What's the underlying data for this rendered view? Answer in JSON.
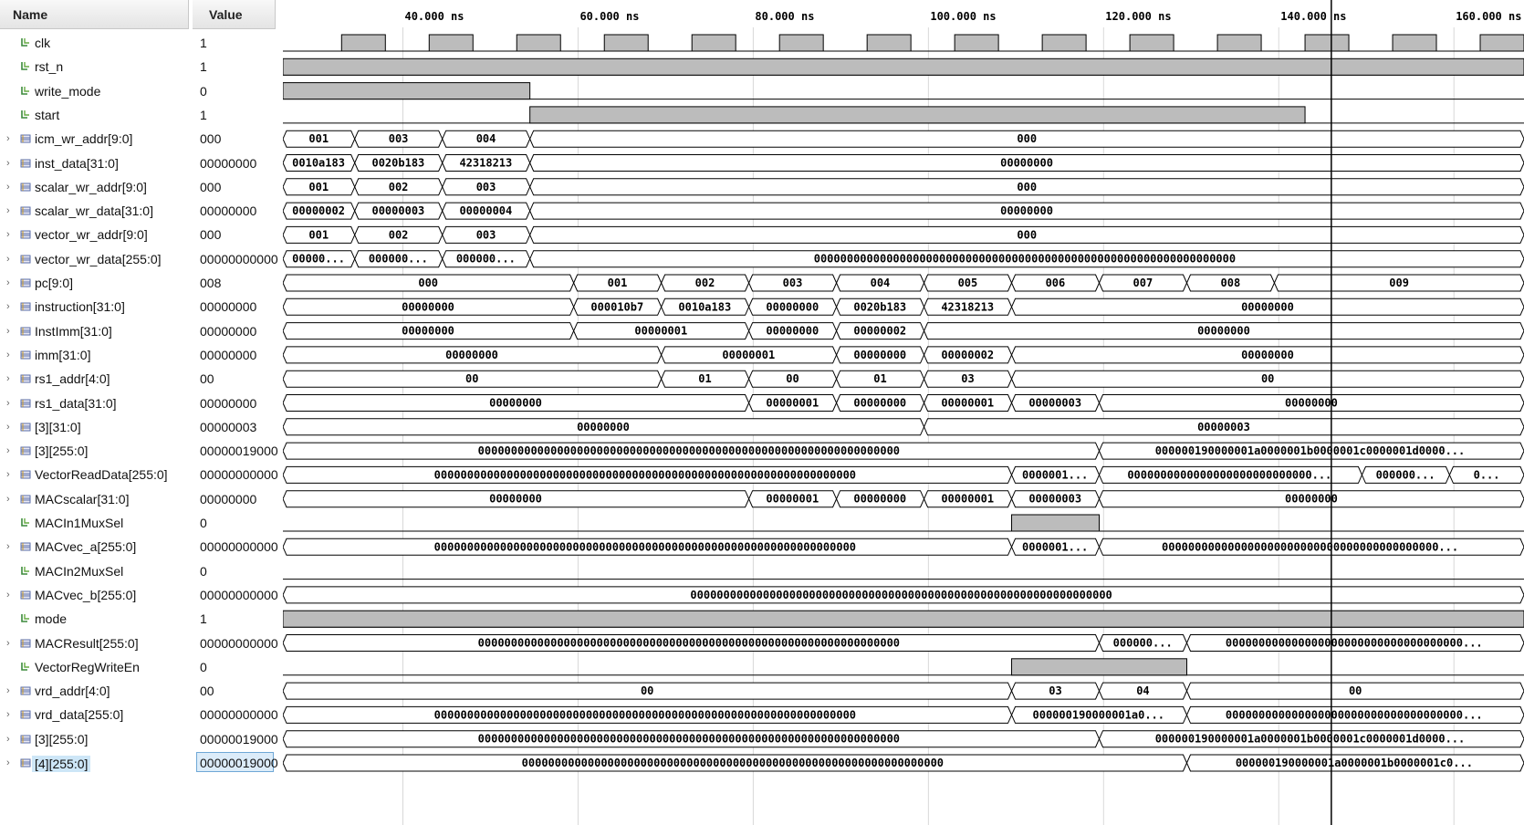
{
  "headers": {
    "name": "Name",
    "value": "Value"
  },
  "timeline": {
    "ticks": [
      "40.000 ns",
      "60.000 ns",
      "80.000 ns",
      "100.000 ns",
      "120.000 ns",
      "140.000 ns",
      "160.000 ns"
    ],
    "tick_ns": [
      40,
      60,
      80,
      100,
      120,
      140,
      160
    ],
    "start_ns": 26.3,
    "end_ns": 168.0,
    "cursor_ns": 146.0
  },
  "signals": [
    {
      "name": "clk",
      "value": "1",
      "kind": "bit",
      "clock": {
        "period": 10,
        "first_rise": 33
      }
    },
    {
      "name": "rst_n",
      "value": "1",
      "kind": "bit",
      "high": [
        [
          26.3,
          168
        ]
      ]
    },
    {
      "name": "write_mode",
      "value": "0",
      "kind": "bit",
      "high": [
        [
          26.3,
          54.5
        ]
      ]
    },
    {
      "name": "start",
      "value": "1",
      "kind": "bit",
      "high": [
        [
          54.5,
          143
        ]
      ]
    },
    {
      "name": "icm_wr_addr[9:0]",
      "value": "000",
      "kind": "bus",
      "segs": [
        [
          26.3,
          34.5,
          "001"
        ],
        [
          34.5,
          44.5,
          "003"
        ],
        [
          44.5,
          54.5,
          "004"
        ],
        [
          54.5,
          168,
          "000"
        ]
      ]
    },
    {
      "name": "inst_data[31:0]",
      "value": "00000000",
      "kind": "bus",
      "segs": [
        [
          26.3,
          34.5,
          "0010a183"
        ],
        [
          34.5,
          44.5,
          "0020b183"
        ],
        [
          44.5,
          54.5,
          "42318213"
        ],
        [
          54.5,
          168,
          "00000000"
        ]
      ]
    },
    {
      "name": "scalar_wr_addr[9:0]",
      "value": "000",
      "kind": "bus",
      "segs": [
        [
          26.3,
          34.5,
          "001"
        ],
        [
          34.5,
          44.5,
          "002"
        ],
        [
          44.5,
          54.5,
          "003"
        ],
        [
          54.5,
          168,
          "000"
        ]
      ]
    },
    {
      "name": "scalar_wr_data[31:0]",
      "value": "00000000",
      "kind": "bus",
      "segs": [
        [
          26.3,
          34.5,
          "00000002"
        ],
        [
          34.5,
          44.5,
          "00000003"
        ],
        [
          44.5,
          54.5,
          "00000004"
        ],
        [
          54.5,
          168,
          "00000000"
        ]
      ]
    },
    {
      "name": "vector_wr_addr[9:0]",
      "value": "000",
      "kind": "bus",
      "segs": [
        [
          26.3,
          34.5,
          "001"
        ],
        [
          34.5,
          44.5,
          "002"
        ],
        [
          44.5,
          54.5,
          "003"
        ],
        [
          54.5,
          168,
          "000"
        ]
      ]
    },
    {
      "name": "vector_wr_data[255:0]",
      "value": "00000000000",
      "kind": "bus",
      "segs": [
        [
          26.3,
          34.5,
          "00000..."
        ],
        [
          34.5,
          44.5,
          "000000..."
        ],
        [
          44.5,
          54.5,
          "000000..."
        ],
        [
          54.5,
          168,
          "0000000000000000000000000000000000000000000000000000000000000000"
        ]
      ]
    },
    {
      "name": "pc[9:0]",
      "value": "008",
      "kind": "bus",
      "segs": [
        [
          26.3,
          59.5,
          "000"
        ],
        [
          59.5,
          69.5,
          "001"
        ],
        [
          69.5,
          79.5,
          "002"
        ],
        [
          79.5,
          89.5,
          "003"
        ],
        [
          89.5,
          99.5,
          "004"
        ],
        [
          99.5,
          109.5,
          "005"
        ],
        [
          109.5,
          119.5,
          "006"
        ],
        [
          119.5,
          129.5,
          "007"
        ],
        [
          129.5,
          139.5,
          "008"
        ],
        [
          139.5,
          168,
          "009"
        ]
      ]
    },
    {
      "name": "instruction[31:0]",
      "value": "00000000",
      "kind": "bus",
      "segs": [
        [
          26.3,
          59.5,
          "00000000"
        ],
        [
          59.5,
          69.5,
          "000010b7"
        ],
        [
          69.5,
          79.5,
          "0010a183"
        ],
        [
          79.5,
          89.5,
          "00000000"
        ],
        [
          89.5,
          99.5,
          "0020b183"
        ],
        [
          99.5,
          109.5,
          "42318213"
        ],
        [
          109.5,
          168,
          "00000000"
        ]
      ]
    },
    {
      "name": "InstImm[31:0]",
      "value": "00000000",
      "kind": "bus",
      "segs": [
        [
          26.3,
          59.5,
          "00000000"
        ],
        [
          59.5,
          79.5,
          "00000001"
        ],
        [
          79.5,
          89.5,
          "00000000"
        ],
        [
          89.5,
          99.5,
          "00000002"
        ],
        [
          99.5,
          168,
          "00000000"
        ]
      ]
    },
    {
      "name": "imm[31:0]",
      "value": "00000000",
      "kind": "bus",
      "segs": [
        [
          26.3,
          69.5,
          "00000000"
        ],
        [
          69.5,
          89.5,
          "00000001"
        ],
        [
          89.5,
          99.5,
          "00000000"
        ],
        [
          99.5,
          109.5,
          "00000002"
        ],
        [
          109.5,
          168,
          "00000000"
        ]
      ]
    },
    {
      "name": "rs1_addr[4:0]",
      "value": "00",
      "kind": "bus",
      "segs": [
        [
          26.3,
          69.5,
          "00"
        ],
        [
          69.5,
          79.5,
          "01"
        ],
        [
          79.5,
          89.5,
          "00"
        ],
        [
          89.5,
          99.5,
          "01"
        ],
        [
          99.5,
          109.5,
          "03"
        ],
        [
          109.5,
          168,
          "00"
        ]
      ]
    },
    {
      "name": "rs1_data[31:0]",
      "value": "00000000",
      "kind": "bus",
      "segs": [
        [
          26.3,
          79.5,
          "00000000"
        ],
        [
          79.5,
          89.5,
          "00000001"
        ],
        [
          89.5,
          99.5,
          "00000000"
        ],
        [
          99.5,
          109.5,
          "00000001"
        ],
        [
          109.5,
          119.5,
          "00000003"
        ],
        [
          119.5,
          168,
          "00000000"
        ]
      ]
    },
    {
      "name": "[3][31:0]",
      "value": "00000003",
      "kind": "bus",
      "segs": [
        [
          26.3,
          99.5,
          "00000000"
        ],
        [
          99.5,
          168,
          "00000003"
        ]
      ]
    },
    {
      "name": "[3][255:0]",
      "value": "00000019000",
      "kind": "bus",
      "segs": [
        [
          26.3,
          119.5,
          "0000000000000000000000000000000000000000000000000000000000000000"
        ],
        [
          119.5,
          168,
          "000000190000001a0000001b0000001c0000001d0000..."
        ]
      ]
    },
    {
      "name": "VectorReadData[255:0]",
      "value": "00000000000",
      "kind": "bus",
      "segs": [
        [
          26.3,
          109.5,
          "0000000000000000000000000000000000000000000000000000000000000000"
        ],
        [
          109.5,
          119.5,
          "0000001..."
        ],
        [
          119.5,
          149.5,
          "0000000000000000000000000000..."
        ],
        [
          149.5,
          159.5,
          "000000..."
        ],
        [
          159.5,
          168,
          "0..."
        ]
      ]
    },
    {
      "name": "MACscalar[31:0]",
      "value": "00000000",
      "kind": "bus",
      "segs": [
        [
          26.3,
          79.5,
          "00000000"
        ],
        [
          79.5,
          89.5,
          "00000001"
        ],
        [
          89.5,
          99.5,
          "00000000"
        ],
        [
          99.5,
          109.5,
          "00000001"
        ],
        [
          109.5,
          119.5,
          "00000003"
        ],
        [
          119.5,
          168,
          "00000000"
        ]
      ]
    },
    {
      "name": "MACIn1MuxSel",
      "value": "0",
      "kind": "bit",
      "high": [
        [
          109.5,
          119.5
        ]
      ]
    },
    {
      "name": "MACvec_a[255:0]",
      "value": "00000000000",
      "kind": "bus",
      "segs": [
        [
          26.3,
          109.5,
          "0000000000000000000000000000000000000000000000000000000000000000"
        ],
        [
          109.5,
          119.5,
          "0000001..."
        ],
        [
          119.5,
          168,
          "000000000000000000000000000000000000000000..."
        ]
      ]
    },
    {
      "name": "MACIn2MuxSel",
      "value": "0",
      "kind": "bit",
      "high": []
    },
    {
      "name": "MACvec_b[255:0]",
      "value": "00000000000",
      "kind": "bus",
      "segs": [
        [
          26.3,
          168,
          "0000000000000000000000000000000000000000000000000000000000000000"
        ]
      ]
    },
    {
      "name": "mode",
      "value": "1",
      "kind": "bit",
      "high": [
        [
          26.3,
          168
        ]
      ]
    },
    {
      "name": "MACResult[255:0]",
      "value": "00000000000",
      "kind": "bus",
      "segs": [
        [
          26.3,
          119.5,
          "0000000000000000000000000000000000000000000000000000000000000000"
        ],
        [
          119.5,
          129.5,
          "000000..."
        ],
        [
          129.5,
          168,
          "000000000000000000000000000000000000..."
        ]
      ]
    },
    {
      "name": "VectorRegWriteEn",
      "value": "0",
      "kind": "bit",
      "high": [
        [
          109.5,
          129.5
        ]
      ]
    },
    {
      "name": "vrd_addr[4:0]",
      "value": "00",
      "kind": "bus",
      "segs": [
        [
          26.3,
          109.5,
          "00"
        ],
        [
          109.5,
          119.5,
          "03"
        ],
        [
          119.5,
          129.5,
          "04"
        ],
        [
          129.5,
          168,
          "00"
        ]
      ]
    },
    {
      "name": "vrd_data[255:0]",
      "value": "00000000000",
      "kind": "bus",
      "segs": [
        [
          26.3,
          109.5,
          "0000000000000000000000000000000000000000000000000000000000000000"
        ],
        [
          109.5,
          129.5,
          "000000190000001a0..."
        ],
        [
          129.5,
          168,
          "000000000000000000000000000000000000..."
        ]
      ]
    },
    {
      "name": "[3][255:0]",
      "value": "00000019000",
      "kind": "bus",
      "segs": [
        [
          26.3,
          119.5,
          "0000000000000000000000000000000000000000000000000000000000000000"
        ],
        [
          119.5,
          168,
          "000000190000001a0000001b0000001c0000001d0000..."
        ]
      ]
    },
    {
      "name": "[4][255:0]",
      "value": "00000019000",
      "kind": "bus",
      "selected": true,
      "segs": [
        [
          26.3,
          129.5,
          "0000000000000000000000000000000000000000000000000000000000000000"
        ],
        [
          129.5,
          168,
          "000000190000001a0000001b0000001c0..."
        ]
      ]
    }
  ],
  "colors": {
    "bit_fill": "#bcbcbc",
    "grid": "#d8d8d8",
    "cursor": "#000000",
    "selection": "#cde6f7"
  },
  "icons": {
    "bit": "scalar-signal-icon",
    "bus": "bus-signal-icon",
    "expander": "expand-arrow-icon"
  }
}
